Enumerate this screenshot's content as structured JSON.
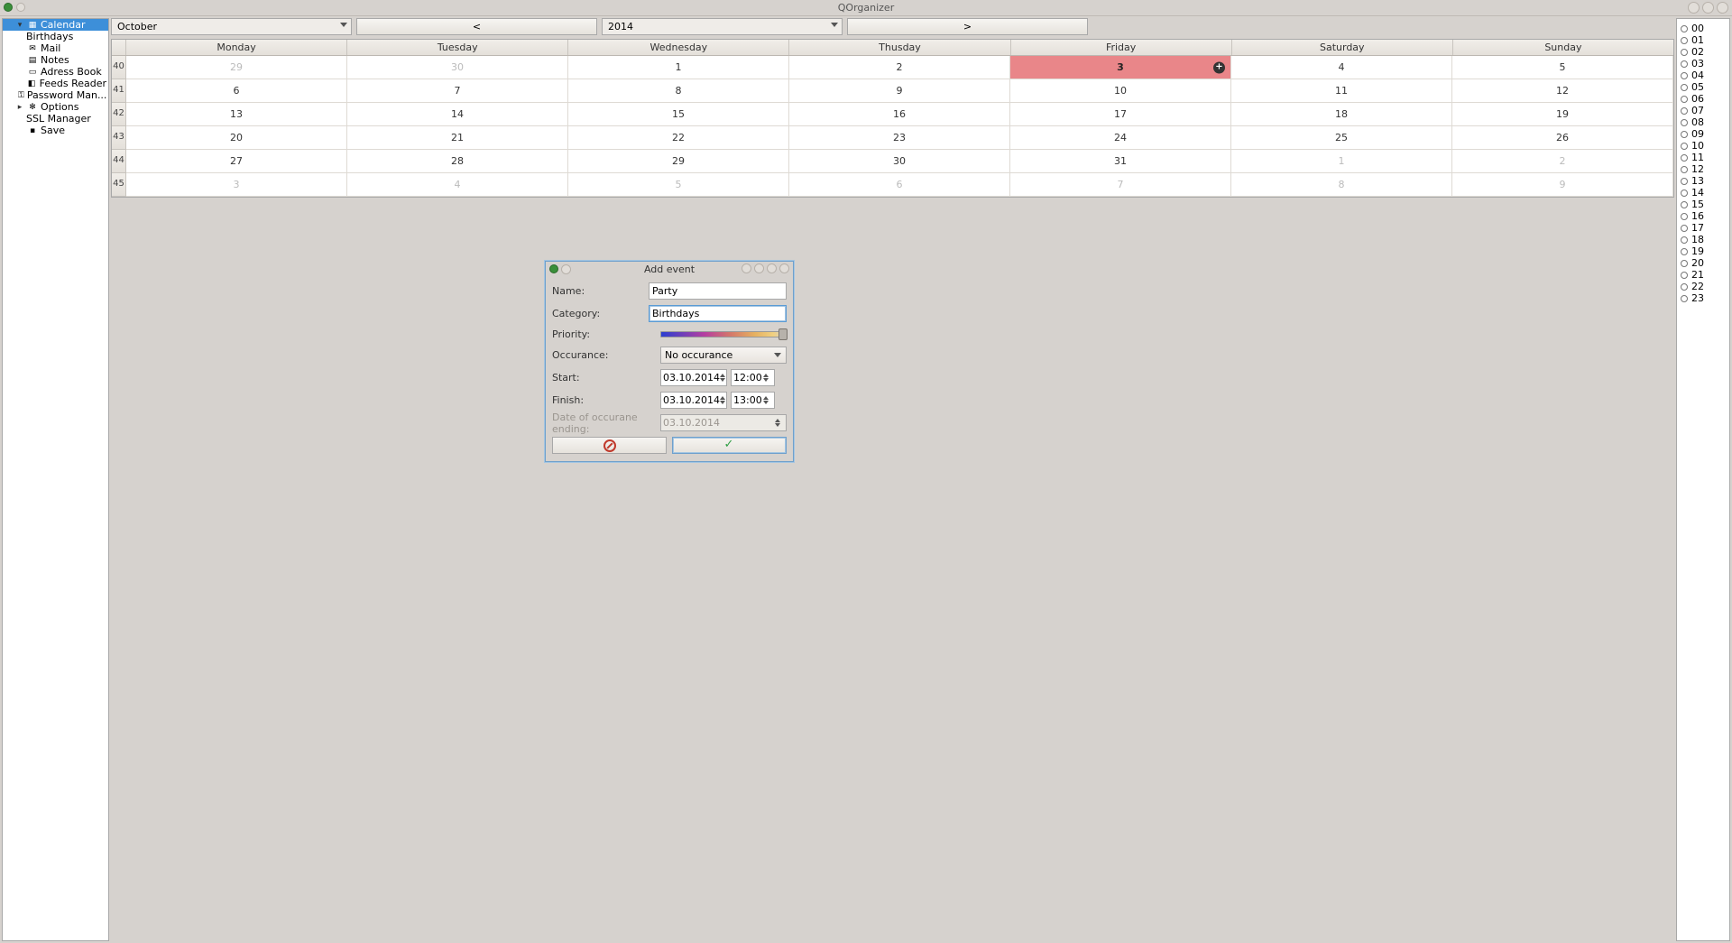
{
  "window": {
    "title": "QOrganizer"
  },
  "sidebar": {
    "items": [
      {
        "label": "Calendar",
        "selected": true,
        "icon": "calendar",
        "exp": "▾"
      },
      {
        "label": "Birthdays",
        "child": true
      },
      {
        "label": "Mail",
        "icon": "mail"
      },
      {
        "label": "Notes",
        "icon": "note"
      },
      {
        "label": "Adress Book",
        "icon": "book"
      },
      {
        "label": "Feeds Reader",
        "icon": "rss"
      },
      {
        "label": "Password Man...",
        "icon": "key"
      },
      {
        "label": "Options",
        "icon": "gear",
        "exp": "▸"
      },
      {
        "label": "SSL Manager",
        "child": true
      },
      {
        "label": "Save",
        "icon": "save"
      }
    ]
  },
  "toolbar": {
    "month": "October",
    "year": "2014",
    "prev": "<",
    "next": ">"
  },
  "calendar": {
    "days": [
      "Monday",
      "Tuesday",
      "Wednesday",
      "Thusday",
      "Friday",
      "Saturday",
      "Sunday"
    ],
    "weeks": [
      {
        "num": "40",
        "cells": [
          {
            "v": "29",
            "muted": true
          },
          {
            "v": "30",
            "muted": true
          },
          {
            "v": "1"
          },
          {
            "v": "2"
          },
          {
            "v": "3",
            "today": true,
            "add": true
          },
          {
            "v": "4"
          },
          {
            "v": "5"
          }
        ]
      },
      {
        "num": "41",
        "cells": [
          {
            "v": "6"
          },
          {
            "v": "7"
          },
          {
            "v": "8"
          },
          {
            "v": "9"
          },
          {
            "v": "10"
          },
          {
            "v": "11"
          },
          {
            "v": "12"
          }
        ]
      },
      {
        "num": "42",
        "cells": [
          {
            "v": "13"
          },
          {
            "v": "14"
          },
          {
            "v": "15"
          },
          {
            "v": "16"
          },
          {
            "v": "17"
          },
          {
            "v": "18"
          },
          {
            "v": "19"
          }
        ]
      },
      {
        "num": "43",
        "cells": [
          {
            "v": "20"
          },
          {
            "v": "21"
          },
          {
            "v": "22"
          },
          {
            "v": "23"
          },
          {
            "v": "24"
          },
          {
            "v": "25"
          },
          {
            "v": "26"
          }
        ]
      },
      {
        "num": "44",
        "cells": [
          {
            "v": "27"
          },
          {
            "v": "28"
          },
          {
            "v": "29"
          },
          {
            "v": "30"
          },
          {
            "v": "31"
          },
          {
            "v": "1",
            "muted": true
          },
          {
            "v": "2",
            "muted": true
          }
        ]
      },
      {
        "num": "45",
        "cells": [
          {
            "v": "3",
            "muted": true
          },
          {
            "v": "4",
            "muted": true
          },
          {
            "v": "5",
            "muted": true
          },
          {
            "v": "6",
            "muted": true
          },
          {
            "v": "7",
            "muted": true
          },
          {
            "v": "8",
            "muted": true
          },
          {
            "v": "9",
            "muted": true
          }
        ]
      }
    ]
  },
  "hours": [
    "00",
    "01",
    "02",
    "03",
    "04",
    "05",
    "06",
    "07",
    "08",
    "09",
    "10",
    "11",
    "12",
    "13",
    "14",
    "15",
    "16",
    "17",
    "18",
    "19",
    "20",
    "21",
    "22",
    "23"
  ],
  "dialog": {
    "title": "Add event",
    "labels": {
      "name": "Name:",
      "category": "Category:",
      "priority": "Priority:",
      "occurance": "Occurance:",
      "start": "Start:",
      "finish": "Finish:",
      "occur_end": "Date of occurane ending:"
    },
    "values": {
      "name": "Party",
      "category": "Birthdays",
      "occurance": "No occurance",
      "start_date": "03.10.2014",
      "start_time": "12:00",
      "finish_date": "03.10.2014",
      "finish_time": "13:00",
      "occur_end_date": "03.10.2014"
    }
  }
}
